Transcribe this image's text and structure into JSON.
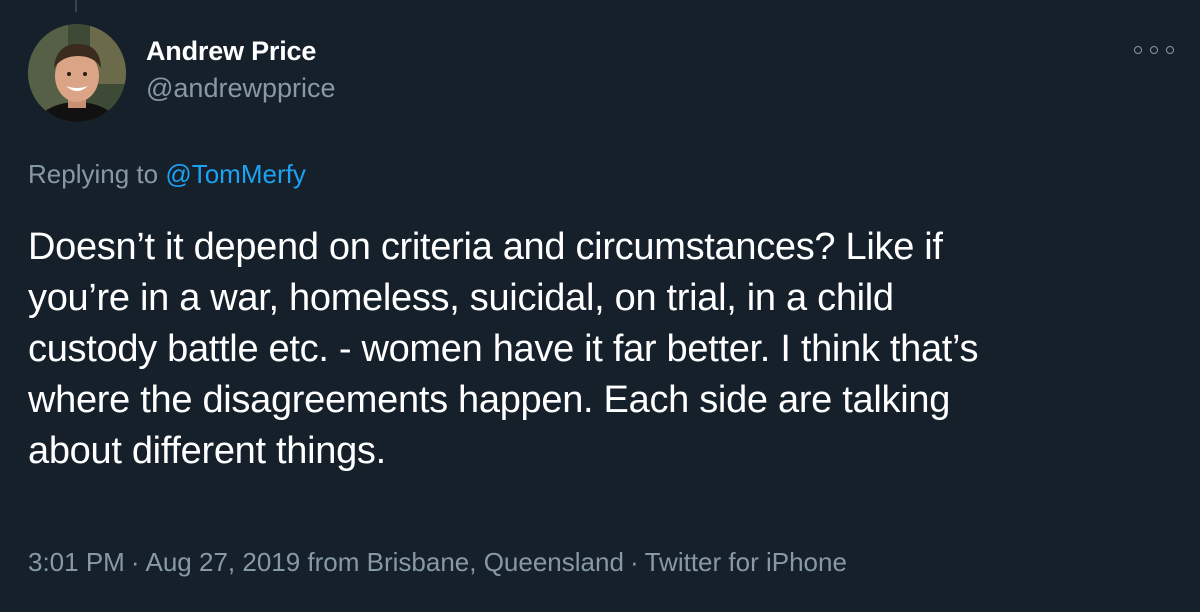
{
  "tweet": {
    "author": {
      "display_name": "Andrew Price",
      "handle": "@andrewpprice"
    },
    "reply_prefix": "Replying to",
    "reply_mention": "@TomMerfy",
    "lines": [
      "Doesn’t it depend on criteria and circumstances? Like if",
      "you’re in a war, homeless, suicidal, on trial, in a child",
      "custody battle etc. - women have it far better. I think that’s",
      "where the disagreements happen. Each side are talking",
      "about different things."
    ],
    "time": "3:01 PM",
    "date_location": "Aug 27, 2019 from Brisbane, Queensland",
    "separator": "·",
    "source": "Twitter for iPhone"
  },
  "icons": {
    "more": "more-options-icon",
    "avatar": "avatar"
  },
  "colors": {
    "background": "#15202b",
    "primary_text": "#ffffff",
    "secondary_text": "#8899a6",
    "link": "#1da1f2"
  }
}
